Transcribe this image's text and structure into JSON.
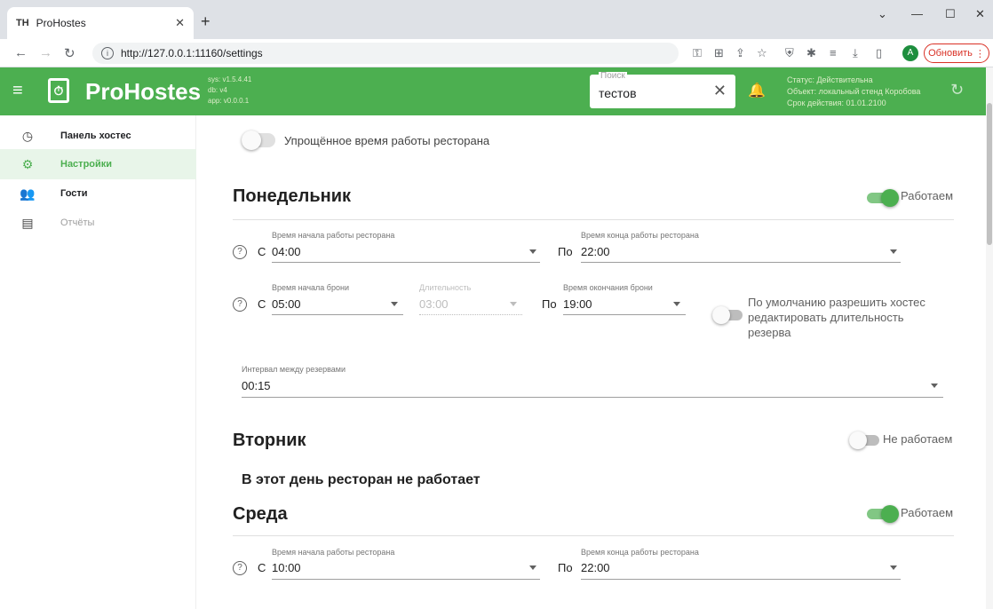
{
  "browser": {
    "tab_title": "ProHostes",
    "favicon_text": "TH",
    "url": "http://127.0.0.1:11160/settings",
    "profile_initial": "A",
    "update_label": "Обновить"
  },
  "header": {
    "brand": "ProHostes",
    "versions": [
      "sys: v1.5.4.41",
      "db: v4",
      "app: v0.0.0.1"
    ],
    "search_label": "Поиск",
    "search_value": "тестов",
    "status_lines": [
      "Статус: Действительна",
      "Объект: локальный стенд Коробова",
      "Срок действия: 01.01.2100"
    ]
  },
  "sidebar": {
    "items": [
      {
        "label": "Панель хостес",
        "icon": "clock-icon"
      },
      {
        "label": "Настройки",
        "icon": "gear-icon",
        "active": true
      },
      {
        "label": "Гости",
        "icon": "people-icon"
      },
      {
        "label": "Отчёты",
        "icon": "report-icon",
        "muted": true
      }
    ]
  },
  "settings": {
    "simplified_label": "Упрощённое время работы ресторана",
    "simplified_on": false,
    "days": {
      "monday": {
        "title": "Понедельник",
        "toggle_label": "Работаем",
        "open_label": "Время начала работы ресторана",
        "open_value": "04:00",
        "close_label": "Время конца работы ресторана",
        "close_value": "22:00",
        "from_prefix": "С",
        "to_prefix": "По",
        "booking_start_label": "Время начала брони",
        "booking_start_value": "05:00",
        "duration_label": "Длительность",
        "duration_value": "03:00",
        "booking_end_label": "Время окончания брони",
        "booking_end_value": "19:00",
        "allow_edit_label_1": "По умолчанию разрешить хостес",
        "allow_edit_label_2": "редактировать длительность",
        "allow_edit_label_3": "резерва",
        "interval_label": "Интервал между резервами",
        "interval_value": "00:15"
      },
      "tuesday": {
        "title": "Вторник",
        "toggle_label": "Не работаем",
        "closed_message": "В этот день ресторан не работает"
      },
      "wednesday": {
        "title": "Среда",
        "toggle_label": "Работаем",
        "open_label": "Время начала работы ресторана",
        "open_value": "10:00",
        "close_label": "Время конца работы ресторана",
        "close_value": "22:00",
        "from_prefix": "С",
        "to_prefix": "По"
      }
    }
  },
  "colors": {
    "brand_green": "#4caf50",
    "update_red": "#d93025"
  }
}
